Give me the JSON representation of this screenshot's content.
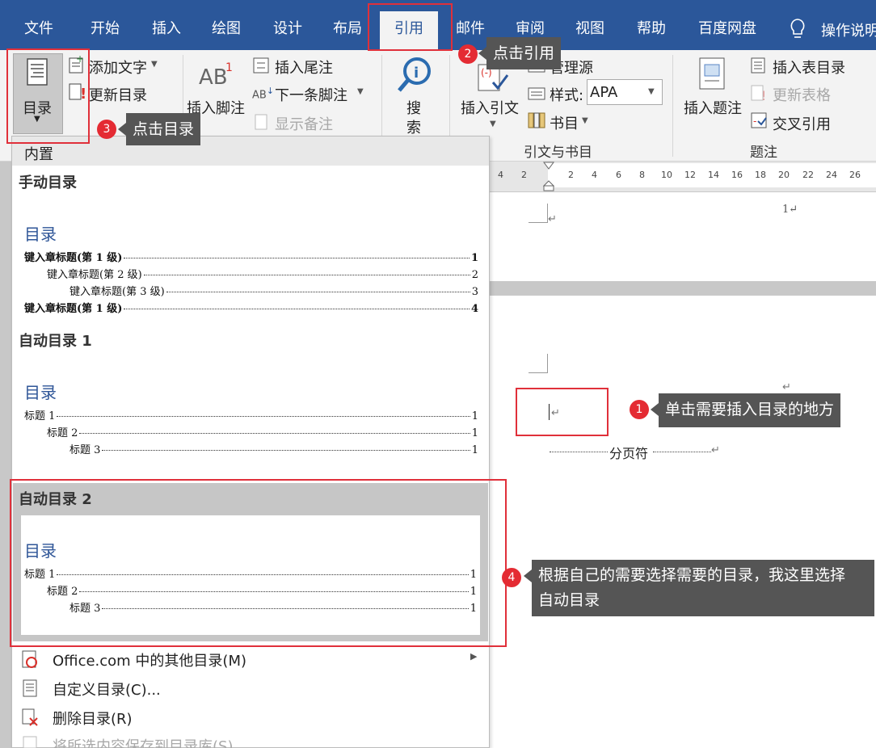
{
  "ribbon_tabs": [
    "文件",
    "开始",
    "插入",
    "绘图",
    "设计",
    "布局",
    "引用",
    "邮件",
    "审阅",
    "视图",
    "帮助",
    "百度网盘"
  ],
  "active_tab": "引用",
  "tell_me": "操作说明",
  "ribbon": {
    "toc_button": "目录",
    "add_text": "添加文字",
    "update_toc": "更新目录",
    "insert_footnote": "插入脚注",
    "insert_endnote": "插入尾注",
    "next_footnote": "下一条脚注",
    "show_notes": "显示备注",
    "search_line1": "搜",
    "search_line2": "索",
    "insert_citation": "插入引文",
    "manage_sources": "管理源",
    "style_label": "样式:",
    "style_value": "APA",
    "bibliography": "书目",
    "group_citations": "引文与书目",
    "insert_caption": "插入题注",
    "insert_table_of_figures": "插入表目录",
    "update_table": "更新表格",
    "cross_reference": "交叉引用",
    "group_captions": "题注"
  },
  "ruler_ticks": [
    "4",
    "2",
    "2",
    "4",
    "6",
    "8",
    "10",
    "12",
    "14",
    "16",
    "18",
    "20",
    "22",
    "24",
    "26"
  ],
  "document": {
    "page_number": "1↵",
    "cursor_mark": "↵",
    "para_mark": "↵",
    "page_break": "分页符"
  },
  "dropdown": {
    "header": "内置",
    "manual_title": "手动目录",
    "auto1_title": "自动目录 1",
    "auto2_title": "自动目录 2",
    "toc_heading": "目录",
    "manual_entries": [
      {
        "label": "键入章标题(第 1 级)",
        "page": "1"
      },
      {
        "label": "键入章标题(第 2 级)",
        "page": "2"
      },
      {
        "label": "键入章标题(第 3 级)",
        "page": "3"
      },
      {
        "label": "键入章标题(第 1 级)",
        "page": "4"
      }
    ],
    "auto_entries": [
      {
        "label": "标题 1",
        "page": "1"
      },
      {
        "label": "标题 2",
        "page": "1"
      },
      {
        "label": "标题 3",
        "page": "1"
      }
    ],
    "menu": [
      "Office.com 中的其他目录(M)",
      "自定义目录(C)...",
      "删除目录(R)",
      "将所选内容保存到目录库(S)..."
    ]
  },
  "annotations": {
    "step1_num": "1",
    "step1_text": "单击需要插入目录的地方",
    "step2_num": "2",
    "step2_text": "点击引用",
    "step3_num": "3",
    "step3_text": "点击目录",
    "step4_num": "4",
    "step4_text_line1": "根据自己的需要选择需要的目录，我这里选择",
    "step4_text_line2": "自动目录"
  },
  "colors": {
    "ribbon_blue": "#2b579a",
    "annotation_red": "#e0303a",
    "callout_gray": "#555555",
    "toc_heading_blue": "#2e5597"
  }
}
